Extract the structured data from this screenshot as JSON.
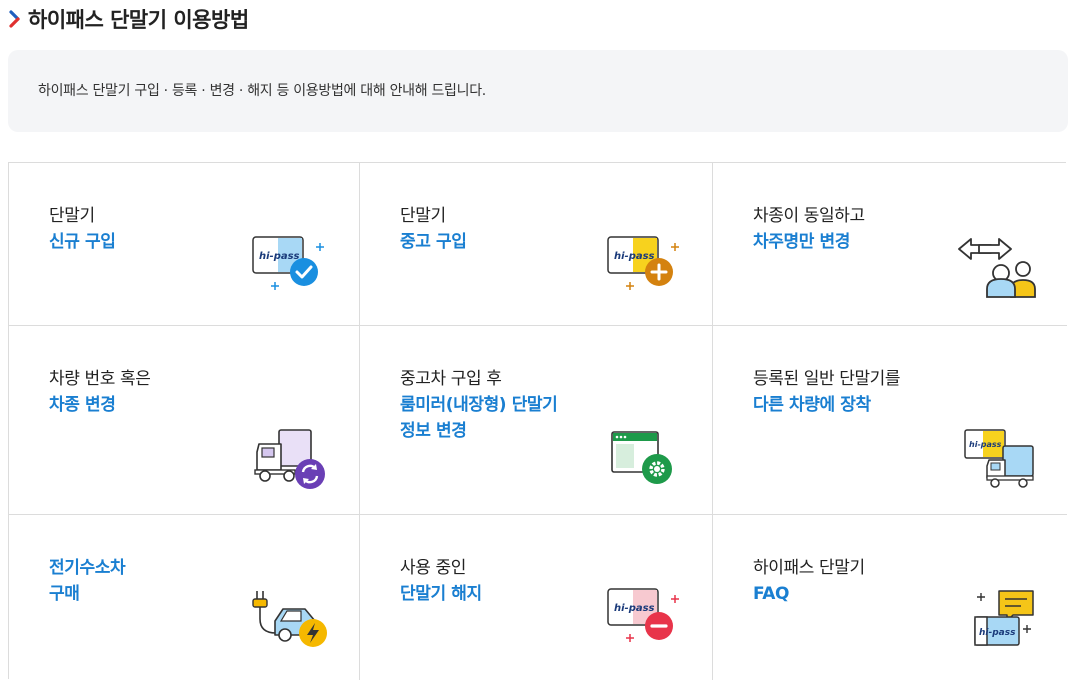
{
  "page": {
    "title": "하이패스 단말기 이용방법",
    "intro": "하이패스 단말기 구입 · 등록 · 변경 · 해지 등 이용방법에 대해 안내해 드립니다."
  },
  "cards": [
    {
      "line1": "단말기",
      "line2": "신규 구입",
      "icon": "hipass-card-check-icon",
      "accent": "#1a8fe0"
    },
    {
      "line1": "단말기",
      "line2": "중고 구입",
      "icon": "hipass-card-plus-icon",
      "accent": "#e08a12"
    },
    {
      "line1": "차종이 동일하고",
      "line2": "차주명만 변경",
      "icon": "owner-swap-icon",
      "accent": "#f5c518"
    },
    {
      "line1": "차량 번호 혹은",
      "line2": "차종 변경",
      "icon": "truck-refresh-icon",
      "accent": "#6a3fb5"
    },
    {
      "line1": "중고차 구입 후",
      "line2": "룸미러(내장형) 단말기\n정보 변경",
      "icon": "window-settings-icon",
      "accent": "#1e9a4a"
    },
    {
      "line1": "등록된 일반 단말기를",
      "line2": "다른 차량에 장착",
      "icon": "card-to-truck-icon",
      "accent": "#f5c518"
    },
    {
      "line1": "",
      "line2": "전기수소차\n구매",
      "icon": "ev-charge-icon",
      "accent": "#f5b800"
    },
    {
      "line1": "사용 중인",
      "line2": "단말기 해지",
      "icon": "hipass-card-minus-icon",
      "accent": "#e8344a"
    },
    {
      "line1": "하이패스 단말기",
      "line2": "FAQ",
      "icon": "faq-chat-icon",
      "accent": "#f5c518"
    }
  ],
  "icon_labels": {
    "hipass": "hi-pass"
  },
  "colors": {
    "accent_blue": "#1a7fd1",
    "border": "#dcdcdc",
    "intro_bg": "#f4f5f7",
    "chevron_blue": "#1f5fbf",
    "chevron_red": "#e0302f"
  }
}
